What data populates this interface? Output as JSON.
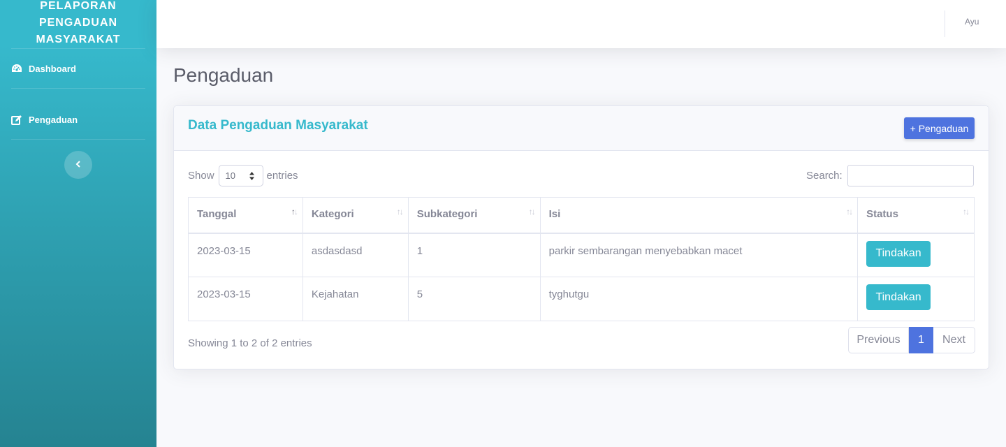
{
  "sidebar": {
    "brand": [
      "PELAPORAN",
      "PENGADUAN",
      "MASYARAKAT"
    ],
    "items": [
      {
        "label": "Dashboard",
        "icon": "tachometer-icon"
      },
      {
        "label": "Pengaduan",
        "icon": "edit-icon"
      }
    ],
    "toggle_icon": "chevron-left-icon"
  },
  "topbar": {
    "user": "Ayu"
  },
  "page": {
    "title": "Pengaduan"
  },
  "card": {
    "title": "Data Pengaduan Masyarakat",
    "add_button": "+ Pengaduan",
    "show_label": "Show",
    "entries_value": "10",
    "entries_label": "entries",
    "search_label": "Search:",
    "search_value": "",
    "columns": [
      "Tanggal",
      "Kategori",
      "Subkategori",
      "Isi",
      "Status"
    ],
    "rows": [
      {
        "tanggal": "2023-03-15",
        "kategori": "asdasdasd",
        "subkategori": "1",
        "isi": "parkir sembarangan menyebabkan macet",
        "action": "Tindakan"
      },
      {
        "tanggal": "2023-03-15",
        "kategori": "Kejahatan",
        "subkategori": "5",
        "isi": "tyghutgu",
        "action": "Tindakan"
      }
    ],
    "info": "Showing 1 to 2 of 2 entries",
    "pagination": {
      "previous": "Previous",
      "page": "1",
      "next": "Next"
    }
  },
  "colors": {
    "accent": "#36b9cc",
    "primary": "#4e73df",
    "text": "#858796"
  }
}
